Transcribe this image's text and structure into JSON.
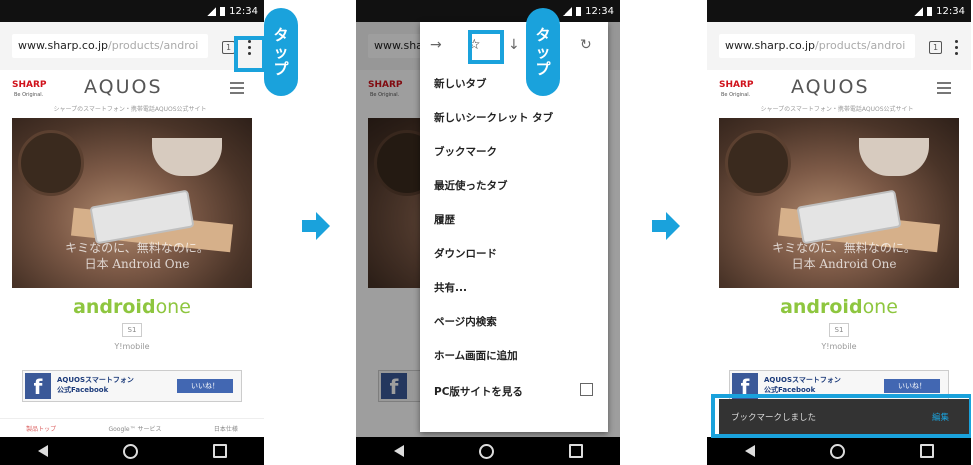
{
  "status": {
    "time": "12:34"
  },
  "browser": {
    "url_main": "www.sharp.co.jp",
    "url_path": "/products/androi",
    "url_short": "www.sharp",
    "tab_count": "1"
  },
  "site": {
    "logo": "SHARP",
    "logo_sub": "Be Original.",
    "brand": "AQUOS",
    "tagline": "シャープのスマートフォン・携帯電話AQUOS公式サイト",
    "photo_text_1": "キミなのに、無料なのに。",
    "photo_text_2": "日本 Android One",
    "android_logo_a": "android",
    "android_logo_b": "one",
    "model": "S1",
    "carrier": "Y!mobile",
    "facebook_line1": "AQUOSスマートフォン",
    "facebook_line2": "公式Facebook",
    "like_button": "いいね！",
    "footer_links": [
      "製品トップ",
      "Google™ サービス",
      "日本仕様"
    ]
  },
  "menu": {
    "forward_icon": "→",
    "bookmark_icon": "☆",
    "download_icon": "↓",
    "info_icon": "ⓘ",
    "reload_icon": "↻",
    "items": [
      "新しいタブ",
      "新しいシークレット タブ",
      "ブックマーク",
      "最近使ったタブ",
      "履歴",
      "ダウンロード",
      "共有...",
      "ページ内検索",
      "ホーム画面に追加",
      "PC版サイトを見る"
    ]
  },
  "callout": {
    "label": [
      "タ",
      "ッ",
      "プ"
    ]
  },
  "snackbar": {
    "message": "ブックマークしました",
    "action": "編集"
  },
  "colors": {
    "accent": "#1aa2dc",
    "android_green": "#8ec63f",
    "sharp_red": "#d0121b"
  }
}
